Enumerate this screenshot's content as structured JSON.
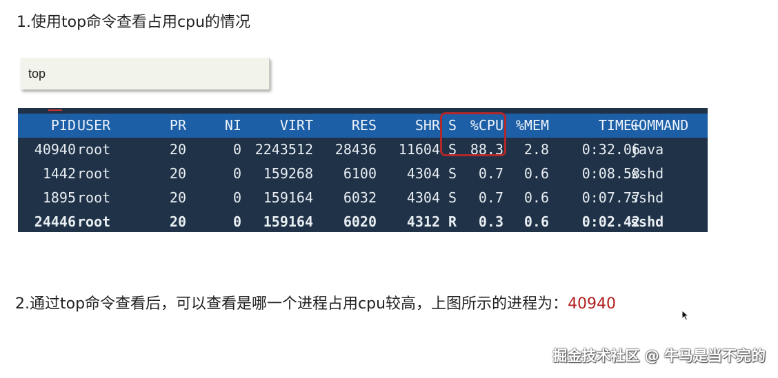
{
  "heading": "1.使用top命令查看占用cpu的情况",
  "code": "top",
  "terminal": {
    "headers": [
      "PID",
      "USER",
      "PR",
      "NI",
      "VIRT",
      "RES",
      "SHR",
      "S",
      "%CPU",
      "%MEM",
      "TIME+",
      "COMMAND"
    ],
    "rows": [
      [
        "40940",
        "root",
        "20",
        "0",
        "2243512",
        "28436",
        "11604",
        "S",
        "88.3",
        "2.8",
        "0:32.06",
        "java"
      ],
      [
        "1442",
        "root",
        "20",
        "0",
        "159268",
        "6100",
        "4304",
        "S",
        "0.7",
        "0.6",
        "0:08.58",
        "sshd"
      ],
      [
        "1895",
        "root",
        "20",
        "0",
        "159164",
        "6032",
        "4304",
        "S",
        "0.7",
        "0.6",
        "0:07.77",
        "sshd"
      ],
      [
        "24446",
        "root",
        "20",
        "0",
        "159164",
        "6020",
        "4312",
        "R",
        "0.3",
        "0.6",
        "0:02.42",
        "sshd"
      ]
    ]
  },
  "answer": {
    "text": "2.通过top命令查看后，可以查看是哪一个进程占用cpu较高，上图所示的进程为：",
    "pid": "40940"
  },
  "watermark": "掘金技术社区 @ 牛马是当不完的",
  "colors": {
    "terminal_bg": "#1f3247",
    "header_bg": "#1c5fa6",
    "highlight": "#b2282a",
    "answer_pid": "#b01f1f"
  },
  "icons": {
    "cursor": "mouse-pointer-icon"
  }
}
